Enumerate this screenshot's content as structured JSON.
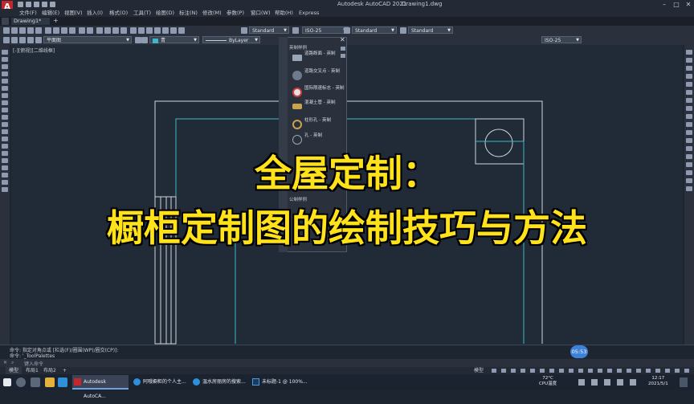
{
  "app": {
    "title": "Autodesk AutoCAD 2021",
    "file": "Drawing1.dwg",
    "logo": "A"
  },
  "menu": [
    "文件(F)",
    "编辑(E)",
    "视图(V)",
    "插入(I)",
    "格式(O)",
    "工具(T)",
    "绘图(D)",
    "标注(N)",
    "修改(M)",
    "参数(P)",
    "窗口(W)",
    "帮助(H)",
    "Express"
  ],
  "tabs": {
    "drawing": "Drawing1*",
    "add": "+"
  },
  "toolbar1": {
    "text_style": "Standard",
    "dim_style": "ISO-25",
    "table_style": "Standard",
    "multileader_style": "Standard"
  },
  "toolbar2": {
    "layer": "平面图",
    "color": "青",
    "linetype": "ByLayer",
    "dim_style2": "ISO-25"
  },
  "viewport_label": "[-][俯视][二维线框]",
  "palette": {
    "title": "英制样例",
    "items": [
      {
        "label": "道路断面 - 英制"
      },
      {
        "label": "道路交叉点 - 英制"
      },
      {
        "label": "国际限速标志 - 英制"
      },
      {
        "label": "混凝土管 - 英制"
      },
      {
        "label": "柱形孔 - 英制"
      },
      {
        "label": "孔 - 英制"
      }
    ],
    "title2": "公制样例"
  },
  "headline": {
    "line1": "全屋定制：",
    "line2": "橱柜定制图的绘制技巧与方法"
  },
  "command": {
    "line1": "命令: 指定对角点或 [栏选(F)/圈围(WP)/圈交(CP)]:",
    "line2": "命令: '_ToolPalettes",
    "prompt": "键入命令"
  },
  "clock_badge": "05:53",
  "layout_tabs": [
    "模型",
    "布局1",
    "布局2"
  ],
  "status": {
    "model": "模型"
  },
  "taskbar": {
    "apps": [
      {
        "label": "Autodesk AutoCA..."
      },
      {
        "label": "阿哦橱柜的个人主..."
      },
      {
        "label": "温水房丽房的搜索..."
      },
      {
        "label": "未标题-1 @ 100%..."
      }
    ],
    "temp": "72°C",
    "temp_label": "CPU温度",
    "time": "12:17",
    "date": "2021/5/1"
  },
  "colors": {
    "drawing_bg": "#212b38",
    "headline": "#ffe21a",
    "cyan_lines": "#3fb7c8",
    "white_lines": "#d0d4da"
  }
}
